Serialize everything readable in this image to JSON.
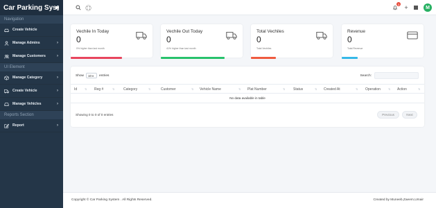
{
  "app": {
    "brand": "Car Parking Sys"
  },
  "sidebar": {
    "sections": [
      "Navigation",
      "UI Element",
      "Reports Section"
    ],
    "items": [
      {
        "label": "Create Vehicle",
        "icon": "car-icon"
      },
      {
        "label": "Manage Admins",
        "icon": "user-icon"
      },
      {
        "label": "Manage Customers",
        "icon": "users-icon"
      },
      {
        "label": "Manage Category",
        "icon": "box-icon"
      },
      {
        "label": "Create Vehicle",
        "icon": "truck-icon"
      },
      {
        "label": "Manage Vehicles",
        "icon": "car-front-icon"
      },
      {
        "label": "Report",
        "icon": "edit-icon"
      }
    ],
    "chevron": "›"
  },
  "topbar": {
    "notification_count": "3",
    "avatar_letter": "M"
  },
  "cards": [
    {
      "title": "Vechile In Today",
      "value": "0",
      "sub": "0% higher than last month",
      "color": "#e8455d"
    },
    {
      "title": "Vechile Out Today",
      "value": "0",
      "sub": "41% higher than last month",
      "color": "#27c26c"
    },
    {
      "title": "Total Vechiles",
      "value": "0",
      "sub": "Total Vechiles",
      "color": "#ef5b3f"
    },
    {
      "title": "Revenue",
      "value": "0",
      "sub": "Total Revenue",
      "color": "#35b8e8"
    }
  ],
  "table": {
    "show_label": "Show",
    "entries_value": "10",
    "entries_label": "entries",
    "search_label": "Search:",
    "columns": [
      "Id",
      "Reg #",
      "Category",
      "Customer",
      "Vehicle Name",
      "Plat Number",
      "Status",
      "Created At",
      "Operation",
      "Action"
    ],
    "empty_text": "No data available in table",
    "info": "Showing 0 to 0 of 0 entries",
    "prev_label": "Previous",
    "next_label": "Next"
  },
  "footer": {
    "copyright": "Copyright © Car Parking System . All Rights Reserved.",
    "credit": "Created by Muneeb,Zaeem,Umair"
  }
}
